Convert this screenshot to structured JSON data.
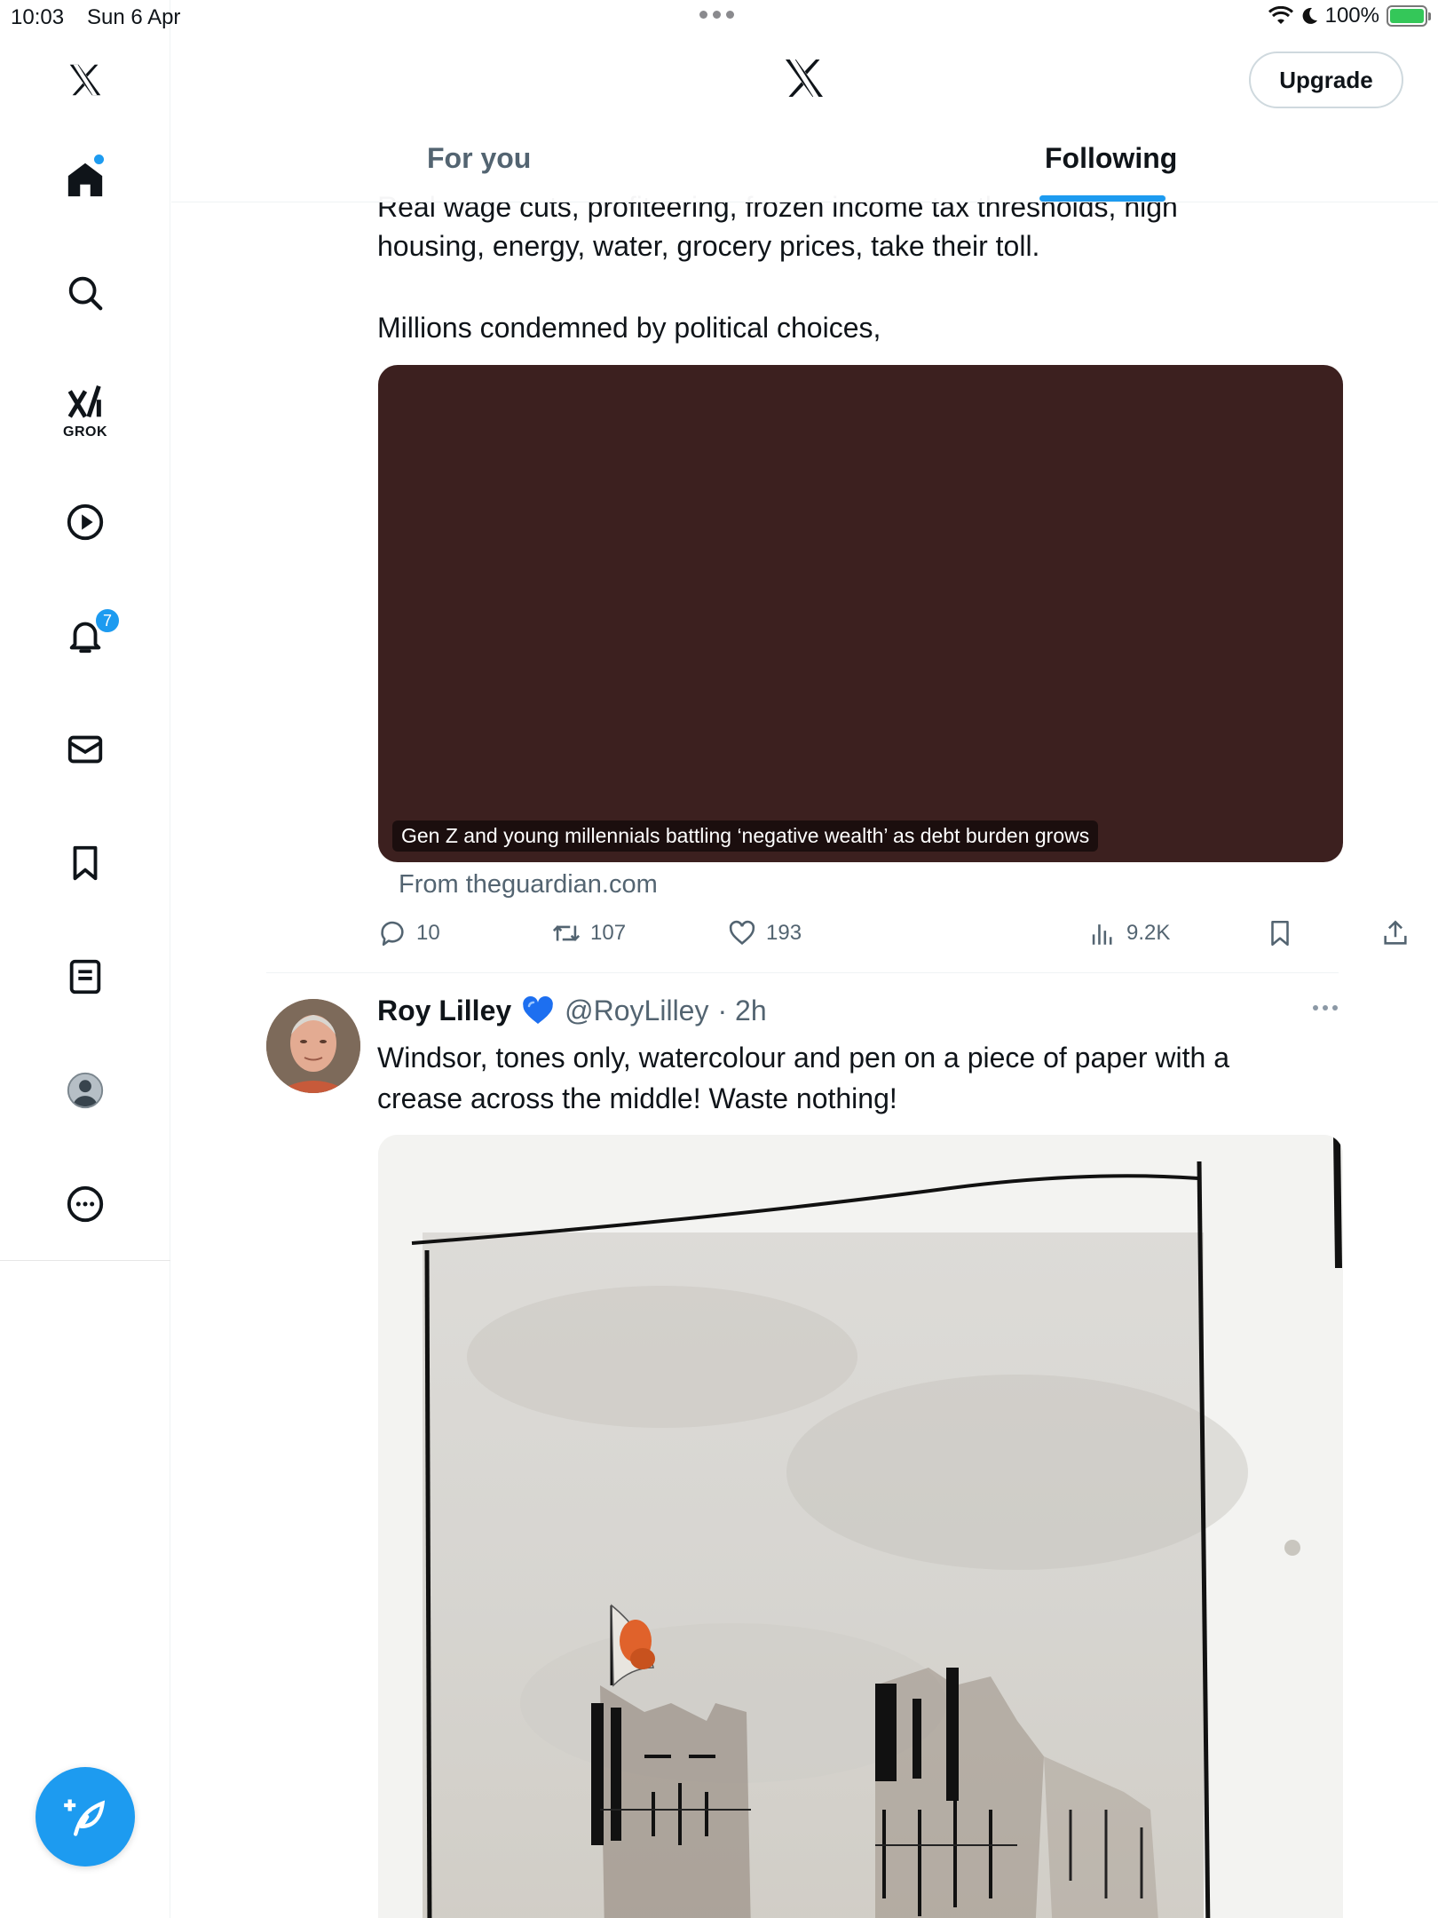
{
  "status_bar": {
    "time": "10:03",
    "date": "Sun 6 Apr",
    "battery": "100%"
  },
  "sidebar": {
    "items": [
      {
        "name": "home",
        "icon": "home-icon"
      },
      {
        "name": "search",
        "icon": "search-icon"
      },
      {
        "name": "grok",
        "icon": "grok-icon",
        "label": "GROK"
      },
      {
        "name": "video",
        "icon": "play-icon"
      },
      {
        "name": "notifications",
        "icon": "bell-icon",
        "badge": "7"
      },
      {
        "name": "messages",
        "icon": "mail-icon"
      },
      {
        "name": "bookmarks",
        "icon": "bookmark-icon"
      },
      {
        "name": "lists",
        "icon": "list-icon"
      },
      {
        "name": "profile",
        "icon": "profile-icon"
      },
      {
        "name": "more",
        "icon": "more-icon"
      }
    ],
    "compose": "compose-icon"
  },
  "header": {
    "upgrade_label": "Upgrade",
    "tabs": [
      {
        "label": "For you",
        "active": false
      },
      {
        "label": "Following",
        "active": true
      }
    ]
  },
  "feed": {
    "post1": {
      "partial_line": "Real wage cuts, profiteering, frozen income tax thresholds, high",
      "line2": "housing, energy, water, grocery prices, take their toll.",
      "line3": "Millions condemned by political choices,",
      "card_caption": "Gen Z and young millennials battling ‘negative wealth’ as debt burden grows",
      "card_source": "From theguardian.com",
      "stats": {
        "replies": "10",
        "reposts": "107",
        "likes": "193",
        "views": "9.2K"
      }
    },
    "post2": {
      "name": "Roy Lilley",
      "handle": "@RoyLilley",
      "time": "· 2h",
      "text_line1": "Windsor, tones only, watercolour and pen on a piece of paper with a",
      "text_line2": "crease across the middle! Waste nothing!"
    }
  },
  "colors": {
    "accent": "#1d9bf0",
    "card_bg": "#3c201f",
    "muted": "#536471"
  }
}
